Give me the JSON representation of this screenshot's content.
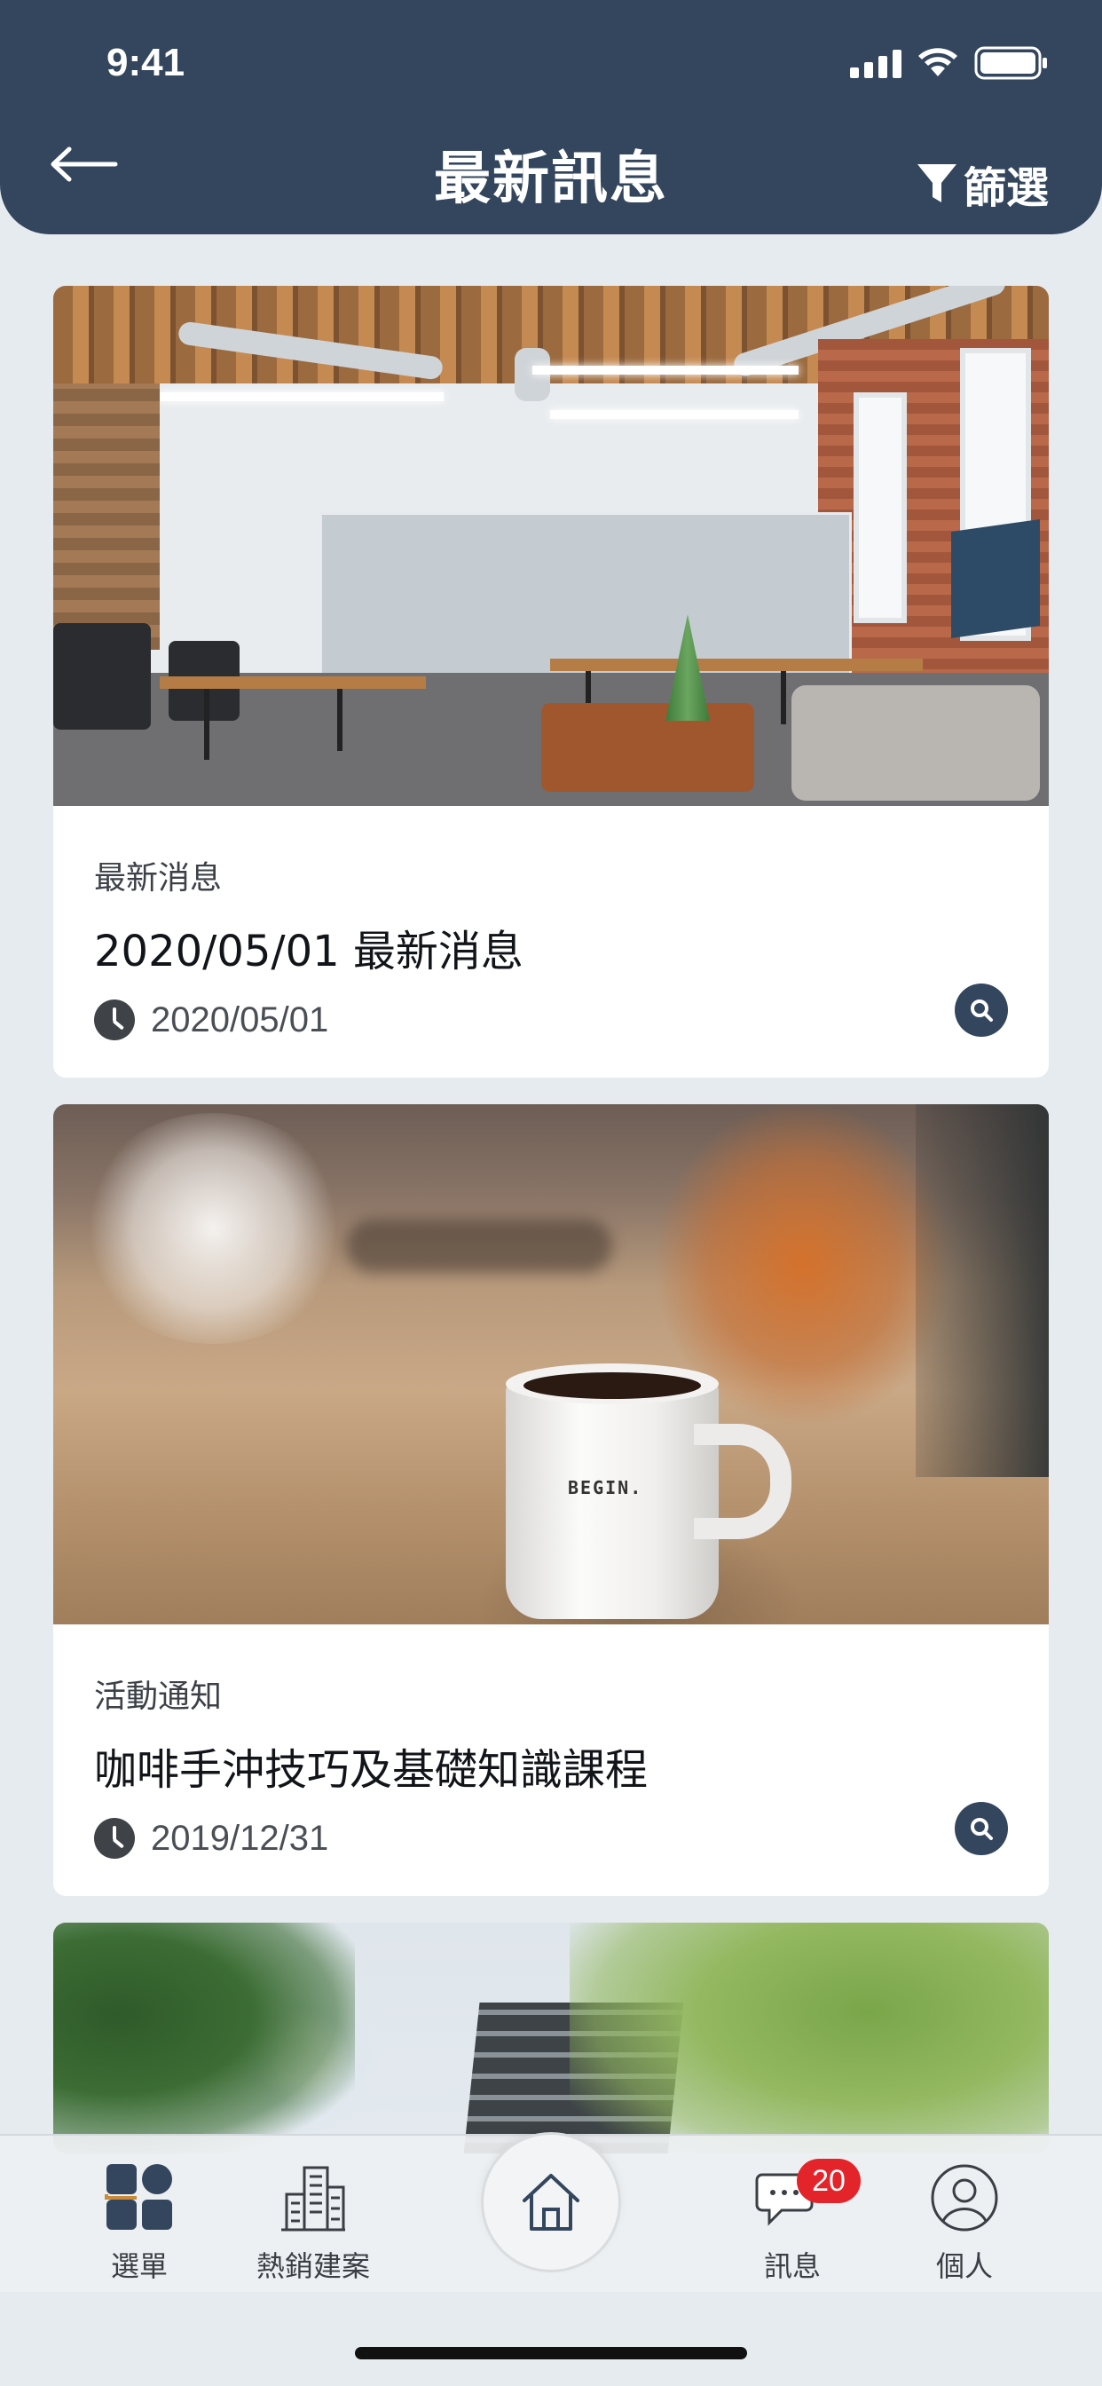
{
  "status_bar": {
    "time": "9:41"
  },
  "header": {
    "title": "最新訊息",
    "filter_label": "篩選"
  },
  "feed": {
    "items": [
      {
        "category": "最新消息",
        "title": "2020/05/01 最新消息",
        "date": "2020/05/01",
        "image": "office-interior"
      },
      {
        "category": "活動通知",
        "title": "咖啡手沖技巧及基礎知識課程",
        "date": "2019/12/31",
        "image": "coffee-mug",
        "image_text": "BEGIN."
      },
      {
        "category": "",
        "title": "",
        "date": "",
        "image": "building-trees"
      }
    ]
  },
  "tabbar": {
    "tabs": [
      {
        "label": "選單",
        "icon": "grid-icon"
      },
      {
        "label": "熱銷建案",
        "icon": "buildings-icon"
      },
      {
        "label": "",
        "icon": "home-icon"
      },
      {
        "label": "訊息",
        "icon": "chat-icon",
        "badge": "20"
      },
      {
        "label": "個人",
        "icon": "user-icon"
      }
    ]
  },
  "colors": {
    "header_bg": "#33465e",
    "page_bg": "#e6ebef",
    "badge": "#e3242b"
  }
}
